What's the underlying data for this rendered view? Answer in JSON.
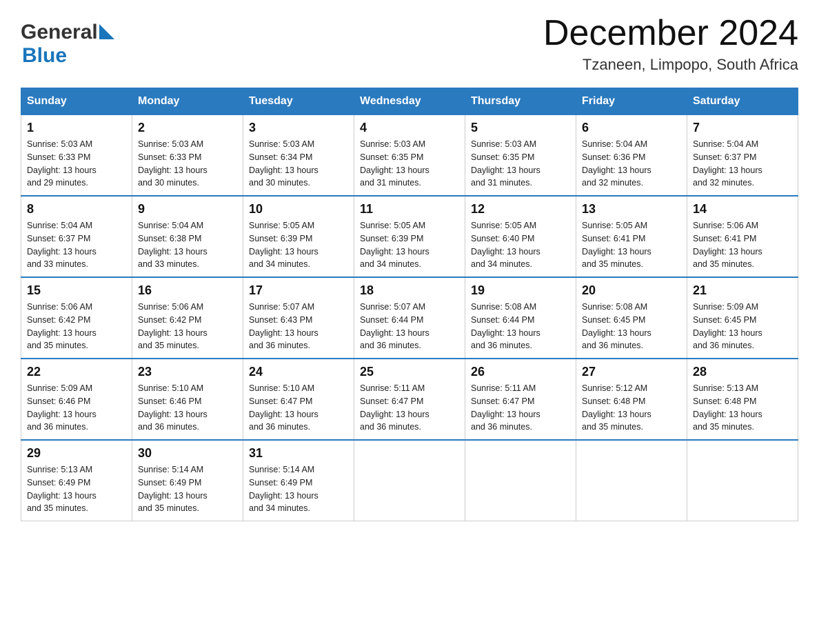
{
  "header": {
    "logo_general": "General",
    "logo_blue": "Blue",
    "month_title": "December 2024",
    "location": "Tzaneen, Limpopo, South Africa"
  },
  "days_of_week": [
    "Sunday",
    "Monday",
    "Tuesday",
    "Wednesday",
    "Thursday",
    "Friday",
    "Saturday"
  ],
  "weeks": [
    [
      {
        "num": "1",
        "sunrise": "5:03 AM",
        "sunset": "6:33 PM",
        "daylight": "13 hours and 29 minutes."
      },
      {
        "num": "2",
        "sunrise": "5:03 AM",
        "sunset": "6:33 PM",
        "daylight": "13 hours and 30 minutes."
      },
      {
        "num": "3",
        "sunrise": "5:03 AM",
        "sunset": "6:34 PM",
        "daylight": "13 hours and 30 minutes."
      },
      {
        "num": "4",
        "sunrise": "5:03 AM",
        "sunset": "6:35 PM",
        "daylight": "13 hours and 31 minutes."
      },
      {
        "num": "5",
        "sunrise": "5:03 AM",
        "sunset": "6:35 PM",
        "daylight": "13 hours and 31 minutes."
      },
      {
        "num": "6",
        "sunrise": "5:04 AM",
        "sunset": "6:36 PM",
        "daylight": "13 hours and 32 minutes."
      },
      {
        "num": "7",
        "sunrise": "5:04 AM",
        "sunset": "6:37 PM",
        "daylight": "13 hours and 32 minutes."
      }
    ],
    [
      {
        "num": "8",
        "sunrise": "5:04 AM",
        "sunset": "6:37 PM",
        "daylight": "13 hours and 33 minutes."
      },
      {
        "num": "9",
        "sunrise": "5:04 AM",
        "sunset": "6:38 PM",
        "daylight": "13 hours and 33 minutes."
      },
      {
        "num": "10",
        "sunrise": "5:05 AM",
        "sunset": "6:39 PM",
        "daylight": "13 hours and 34 minutes."
      },
      {
        "num": "11",
        "sunrise": "5:05 AM",
        "sunset": "6:39 PM",
        "daylight": "13 hours and 34 minutes."
      },
      {
        "num": "12",
        "sunrise": "5:05 AM",
        "sunset": "6:40 PM",
        "daylight": "13 hours and 34 minutes."
      },
      {
        "num": "13",
        "sunrise": "5:05 AM",
        "sunset": "6:41 PM",
        "daylight": "13 hours and 35 minutes."
      },
      {
        "num": "14",
        "sunrise": "5:06 AM",
        "sunset": "6:41 PM",
        "daylight": "13 hours and 35 minutes."
      }
    ],
    [
      {
        "num": "15",
        "sunrise": "5:06 AM",
        "sunset": "6:42 PM",
        "daylight": "13 hours and 35 minutes."
      },
      {
        "num": "16",
        "sunrise": "5:06 AM",
        "sunset": "6:42 PM",
        "daylight": "13 hours and 35 minutes."
      },
      {
        "num": "17",
        "sunrise": "5:07 AM",
        "sunset": "6:43 PM",
        "daylight": "13 hours and 36 minutes."
      },
      {
        "num": "18",
        "sunrise": "5:07 AM",
        "sunset": "6:44 PM",
        "daylight": "13 hours and 36 minutes."
      },
      {
        "num": "19",
        "sunrise": "5:08 AM",
        "sunset": "6:44 PM",
        "daylight": "13 hours and 36 minutes."
      },
      {
        "num": "20",
        "sunrise": "5:08 AM",
        "sunset": "6:45 PM",
        "daylight": "13 hours and 36 minutes."
      },
      {
        "num": "21",
        "sunrise": "5:09 AM",
        "sunset": "6:45 PM",
        "daylight": "13 hours and 36 minutes."
      }
    ],
    [
      {
        "num": "22",
        "sunrise": "5:09 AM",
        "sunset": "6:46 PM",
        "daylight": "13 hours and 36 minutes."
      },
      {
        "num": "23",
        "sunrise": "5:10 AM",
        "sunset": "6:46 PM",
        "daylight": "13 hours and 36 minutes."
      },
      {
        "num": "24",
        "sunrise": "5:10 AM",
        "sunset": "6:47 PM",
        "daylight": "13 hours and 36 minutes."
      },
      {
        "num": "25",
        "sunrise": "5:11 AM",
        "sunset": "6:47 PM",
        "daylight": "13 hours and 36 minutes."
      },
      {
        "num": "26",
        "sunrise": "5:11 AM",
        "sunset": "6:47 PM",
        "daylight": "13 hours and 36 minutes."
      },
      {
        "num": "27",
        "sunrise": "5:12 AM",
        "sunset": "6:48 PM",
        "daylight": "13 hours and 35 minutes."
      },
      {
        "num": "28",
        "sunrise": "5:13 AM",
        "sunset": "6:48 PM",
        "daylight": "13 hours and 35 minutes."
      }
    ],
    [
      {
        "num": "29",
        "sunrise": "5:13 AM",
        "sunset": "6:49 PM",
        "daylight": "13 hours and 35 minutes."
      },
      {
        "num": "30",
        "sunrise": "5:14 AM",
        "sunset": "6:49 PM",
        "daylight": "13 hours and 35 minutes."
      },
      {
        "num": "31",
        "sunrise": "5:14 AM",
        "sunset": "6:49 PM",
        "daylight": "13 hours and 34 minutes."
      },
      null,
      null,
      null,
      null
    ]
  ],
  "labels": {
    "sunrise": "Sunrise:",
    "sunset": "Sunset:",
    "daylight": "Daylight:"
  }
}
